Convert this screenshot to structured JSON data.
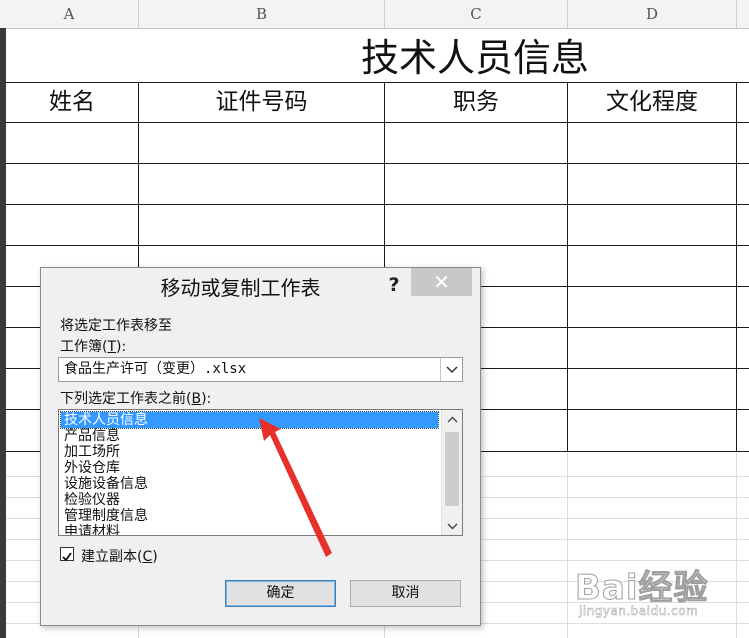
{
  "sheet": {
    "columns": [
      "A",
      "B",
      "C",
      "D"
    ],
    "title": "技术人员信息",
    "headers": [
      "姓名",
      "证件号码",
      "职务",
      "文化程度"
    ]
  },
  "dialog": {
    "title": "移动或复制工作表",
    "help": "?",
    "close": "✕",
    "move_to_label": "将选定工作表移至",
    "workbook_label_prefix": "工作簿(",
    "workbook_label_key": "T",
    "workbook_label_suffix": "):",
    "workbook_value": "食品生产许可（变更）.xlsx",
    "before_label_prefix": "下列选定工作表之前(",
    "before_label_key": "B",
    "before_label_suffix": "):",
    "sheets": [
      "技术人员信息",
      "产品信息",
      "加工场所",
      "外设仓库",
      "设施设备信息",
      "检验仪器",
      "管理制度信息",
      "申请材料"
    ],
    "selected_index": 0,
    "copy_label_prefix": "建立副本(",
    "copy_label_key": "C",
    "copy_label_suffix": ")",
    "copy_checked": true,
    "ok": "确定",
    "cancel": "取消"
  },
  "watermark": {
    "logo": "Bai经验",
    "url": "jingyan.baidu.com"
  },
  "colors": {
    "selection": "#3399ff",
    "arrow": "#e8302a",
    "dialog_bg": "#f0f0f0"
  }
}
